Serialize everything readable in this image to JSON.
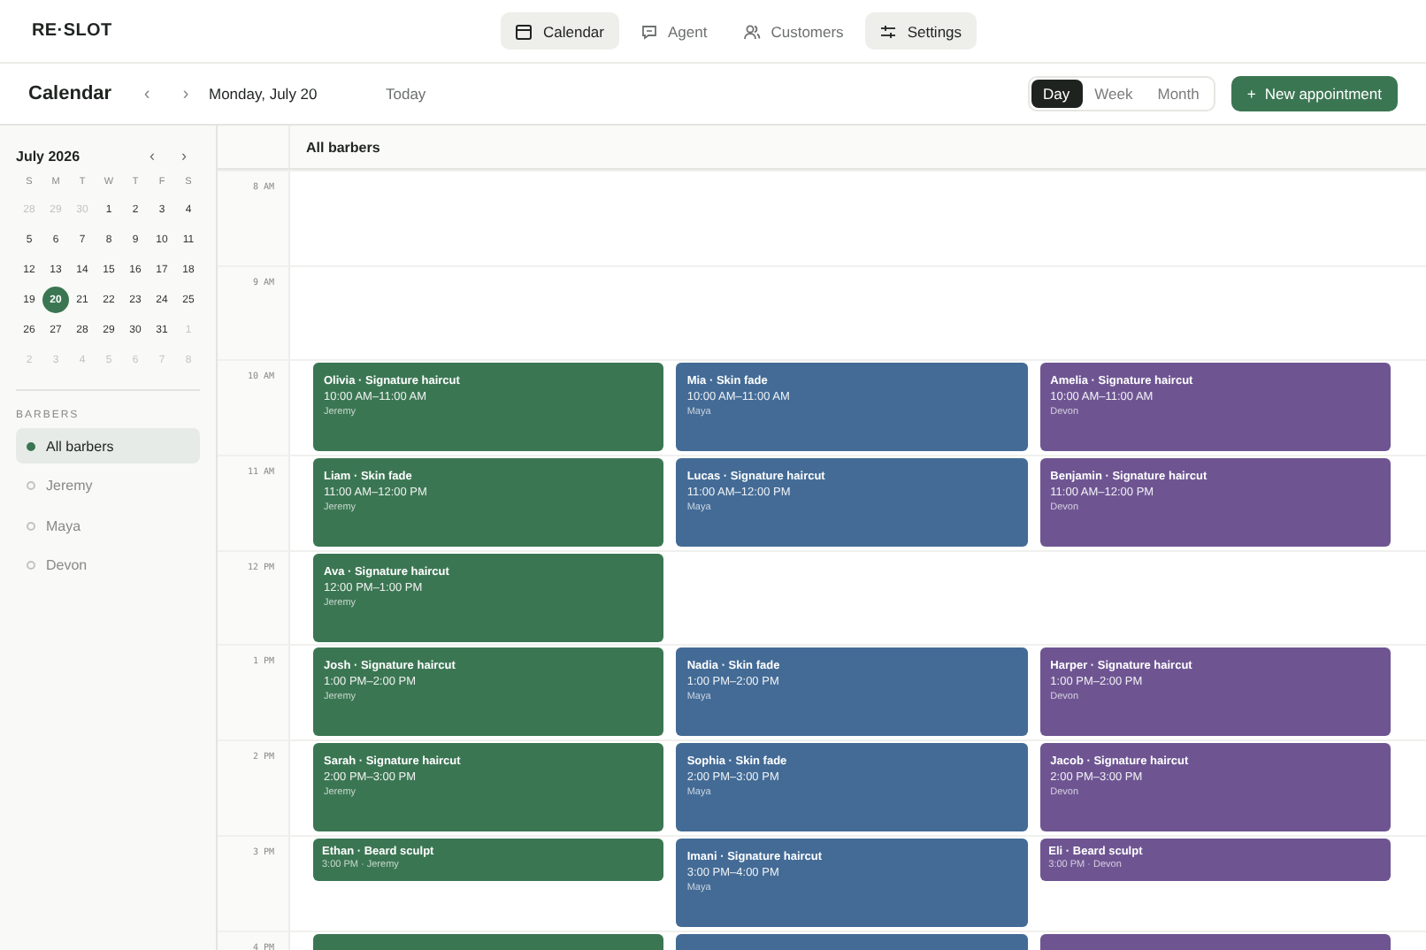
{
  "logo": "RE·SLOT",
  "nav": [
    {
      "label": "Calendar",
      "selected": true
    },
    {
      "label": "Agent",
      "selected": false
    },
    {
      "label": "Customers",
      "selected": false
    },
    {
      "label": "Settings",
      "selected": true
    }
  ],
  "toolbar": {
    "title": "Calendar",
    "prev": "‹",
    "next": "›",
    "date": "Monday, July 20",
    "today": "Today",
    "views": [
      {
        "label": "Day",
        "selected": true
      },
      {
        "label": "Week",
        "selected": false
      },
      {
        "label": "Month",
        "selected": false
      }
    ],
    "new_button": {
      "icon": "+",
      "label": "New appointment"
    }
  },
  "mini_calendar": {
    "month": "July 2026",
    "prev": "‹",
    "next": "›",
    "weekdays": [
      "S",
      "M",
      "T",
      "W",
      "T",
      "F",
      "S"
    ],
    "weeks": [
      [
        {
          "label": "28",
          "muted": true,
          "selected": false
        },
        {
          "label": "29",
          "muted": true,
          "selected": false
        },
        {
          "label": "30",
          "muted": true,
          "selected": false
        },
        {
          "label": "1",
          "muted": false,
          "selected": false
        },
        {
          "label": "2",
          "muted": false,
          "selected": false
        },
        {
          "label": "3",
          "muted": false,
          "selected": false
        },
        {
          "label": "4",
          "muted": false,
          "selected": false
        }
      ],
      [
        {
          "label": "5",
          "muted": false,
          "selected": false
        },
        {
          "label": "6",
          "muted": false,
          "selected": false
        },
        {
          "label": "7",
          "muted": false,
          "selected": false
        },
        {
          "label": "8",
          "muted": false,
          "selected": false
        },
        {
          "label": "9",
          "muted": false,
          "selected": false
        },
        {
          "label": "10",
          "muted": false,
          "selected": false
        },
        {
          "label": "11",
          "muted": false,
          "selected": false
        }
      ],
      [
        {
          "label": "12",
          "muted": false,
          "selected": false
        },
        {
          "label": "13",
          "muted": false,
          "selected": false
        },
        {
          "label": "14",
          "muted": false,
          "selected": false
        },
        {
          "label": "15",
          "muted": false,
          "selected": false
        },
        {
          "label": "16",
          "muted": false,
          "selected": false
        },
        {
          "label": "17",
          "muted": false,
          "selected": false
        },
        {
          "label": "18",
          "muted": false,
          "selected": false
        }
      ],
      [
        {
          "label": "19",
          "muted": false,
          "selected": false
        },
        {
          "label": "20",
          "muted": false,
          "selected": true
        },
        {
          "label": "21",
          "muted": false,
          "selected": false
        },
        {
          "label": "22",
          "muted": false,
          "selected": false
        },
        {
          "label": "23",
          "muted": false,
          "selected": false
        },
        {
          "label": "24",
          "muted": false,
          "selected": false
        },
        {
          "label": "25",
          "muted": false,
          "selected": false
        }
      ],
      [
        {
          "label": "26",
          "muted": false,
          "selected": false
        },
        {
          "label": "27",
          "muted": false,
          "selected": false
        },
        {
          "label": "28",
          "muted": false,
          "selected": false
        },
        {
          "label": "29",
          "muted": false,
          "selected": false
        },
        {
          "label": "30",
          "muted": false,
          "selected": false
        },
        {
          "label": "31",
          "muted": false,
          "selected": false
        },
        {
          "label": "1",
          "muted": true,
          "selected": false
        }
      ],
      [
        {
          "label": "2",
          "muted": true,
          "selected": false
        },
        {
          "label": "3",
          "muted": true,
          "selected": false
        },
        {
          "label": "4",
          "muted": true,
          "selected": false
        },
        {
          "label": "5",
          "muted": true,
          "selected": false
        },
        {
          "label": "6",
          "muted": true,
          "selected": false
        },
        {
          "label": "7",
          "muted": true,
          "selected": false
        },
        {
          "label": "8",
          "muted": true,
          "selected": false
        }
      ]
    ]
  },
  "barbers": {
    "heading": "BARBERS",
    "items": [
      {
        "label": "All barbers",
        "selected": true
      },
      {
        "label": "Jeremy",
        "selected": false
      },
      {
        "label": "Maya",
        "selected": false
      },
      {
        "label": "Devon",
        "selected": false
      }
    ]
  },
  "schedule": {
    "heading": "All barbers",
    "hours": [
      {
        "label": "8 AM",
        "slots": [
          {
            "kind": "empty"
          },
          {
            "kind": "empty"
          },
          {
            "kind": "empty"
          }
        ]
      },
      {
        "label": "9 AM",
        "slots": [
          {
            "kind": "empty"
          },
          {
            "kind": "empty"
          },
          {
            "kind": "empty"
          }
        ]
      },
      {
        "label": "10 AM",
        "slots": [
          {
            "kind": "hour",
            "color": "#3b7653",
            "title": "Olivia · Signature haircut",
            "time": "10:00 AM–11:00 AM",
            "barber": "Jeremy"
          },
          {
            "kind": "hour",
            "color": "#436b96",
            "title": "Mia · Skin fade",
            "time": "10:00 AM–11:00 AM",
            "barber": "Maya"
          },
          {
            "kind": "hour",
            "color": "#6e5592",
            "title": "Amelia · Signature haircut",
            "time": "10:00 AM–11:00 AM",
            "barber": "Devon"
          }
        ]
      },
      {
        "label": "11 AM",
        "slots": [
          {
            "kind": "hour",
            "color": "#3b7653",
            "title": "Liam · Skin fade",
            "time": "11:00 AM–12:00 PM",
            "barber": "Jeremy"
          },
          {
            "kind": "hour",
            "color": "#436b96",
            "title": "Lucas · Signature haircut",
            "time": "11:00 AM–12:00 PM",
            "barber": "Maya"
          },
          {
            "kind": "hour",
            "color": "#6e5592",
            "title": "Benjamin · Signature haircut",
            "time": "11:00 AM–12:00 PM",
            "barber": "Devon"
          }
        ]
      },
      {
        "label": "12 PM",
        "slots": [
          {
            "kind": "hour",
            "color": "#3b7653",
            "title": "Ava · Signature haircut",
            "time": "12:00 PM–1:00 PM",
            "barber": "Jeremy"
          },
          {
            "kind": "empty"
          },
          {
            "kind": "empty"
          }
        ]
      },
      {
        "label": "1 PM",
        "slots": [
          {
            "kind": "hour",
            "color": "#3b7653",
            "title": "Josh · Signature haircut",
            "time": "1:00 PM–2:00 PM",
            "barber": "Jeremy"
          },
          {
            "kind": "hour",
            "color": "#436b96",
            "title": "Nadia · Skin fade",
            "time": "1:00 PM–2:00 PM",
            "barber": "Maya"
          },
          {
            "kind": "hour",
            "color": "#6e5592",
            "title": "Harper · Signature haircut",
            "time": "1:00 PM–2:00 PM",
            "barber": "Devon"
          }
        ]
      },
      {
        "label": "2 PM",
        "slots": [
          {
            "kind": "hour",
            "color": "#3b7653",
            "title": "Sarah · Signature haircut",
            "time": "2:00 PM–3:00 PM",
            "barber": "Jeremy"
          },
          {
            "kind": "hour",
            "color": "#436b96",
            "title": "Sophia · Skin fade",
            "time": "2:00 PM–3:00 PM",
            "barber": "Maya"
          },
          {
            "kind": "hour",
            "color": "#6e5592",
            "title": "Jacob · Signature haircut",
            "time": "2:00 PM–3:00 PM",
            "barber": "Devon"
          }
        ]
      },
      {
        "label": "3 PM",
        "slots": [
          {
            "kind": "short",
            "color": "#3b7653",
            "title": "Ethan · Beard sculpt",
            "detail": "3:00 PM · Jeremy"
          },
          {
            "kind": "hour",
            "color": "#436b96",
            "title": "Imani · Signature haircut",
            "time": "3:00 PM–4:00 PM",
            "barber": "Maya"
          },
          {
            "kind": "short",
            "color": "#6e5592",
            "title": "Eli · Beard sculpt",
            "detail": "3:00 PM · Devon"
          }
        ]
      },
      {
        "label": "4 PM",
        "slots": [
          {
            "kind": "clipped",
            "color": "#3b7653"
          },
          {
            "kind": "clipped",
            "color": "#436b96"
          },
          {
            "kind": "clipped",
            "color": "#6e5592"
          }
        ]
      }
    ]
  }
}
